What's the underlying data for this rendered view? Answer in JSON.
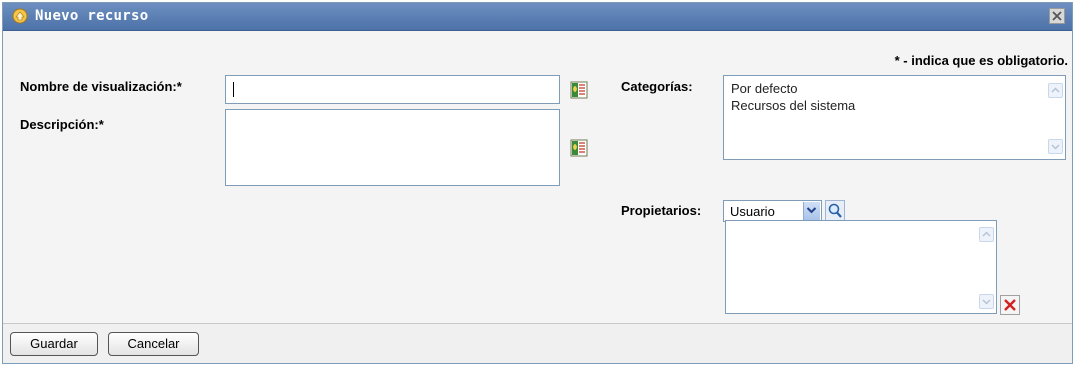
{
  "dialog": {
    "title": "Nuevo recurso",
    "required_note": "* - indica que es obligatorio."
  },
  "form": {
    "display_name": {
      "label": "Nombre de visualización:*",
      "value": ""
    },
    "description": {
      "label": "Descripción:*",
      "value": ""
    },
    "categories": {
      "label": "Categorías:",
      "items": [
        "Por defecto",
        "Recursos del sistema"
      ]
    },
    "owners": {
      "label": "Propietarios:",
      "type_selected": "Usuario",
      "items": []
    }
  },
  "footer": {
    "save_label": "Guardar",
    "cancel_label": "Cancelar"
  },
  "colors": {
    "title_bar": "#5a7db3",
    "field_border": "#7f9db9",
    "delete_red": "#d42020"
  },
  "icons": {
    "title": "resource-icon",
    "close": "close-icon",
    "localize": "language-localize-icon",
    "search": "magnifier-icon",
    "delete": "red-x-icon"
  }
}
